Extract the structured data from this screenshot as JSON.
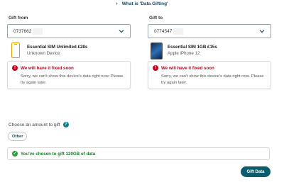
{
  "header": {
    "link_label": "What is 'Data Gifting'"
  },
  "gift_from": {
    "label": "Gift from",
    "number": "0737662",
    "device": {
      "name": "Essential SIM Unlimited £28s",
      "model": "Unknown Device"
    },
    "error": {
      "title": "We will have it fixed soon",
      "message": "Sorry, we can't show this device's data right now. Please try again later."
    }
  },
  "gift_to": {
    "label": "Gift to",
    "number": "0774547",
    "device": {
      "name": "Essential SIM 1GB £15s",
      "model": "Apple iPhone 12"
    },
    "error": {
      "title": "We will have it fixed soon",
      "message": "Sorry, we can't show this device's data right now. Please try again later."
    }
  },
  "amount": {
    "label": "Choose an amount to gift",
    "other_button": "Other"
  },
  "confirmation": {
    "text": "You've chosen to gift 120GB of data"
  },
  "actions": {
    "gift_button": "Gift Data"
  },
  "colors": {
    "primary": "#0b5d6e",
    "error": "#d0021b",
    "success": "#2e9d3f",
    "accent_yellow": "#e0a000"
  }
}
